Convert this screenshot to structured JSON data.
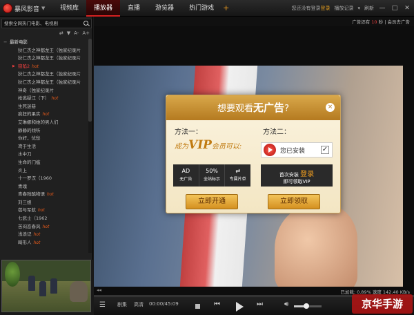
{
  "app": {
    "name": "暴风影音",
    "tabs": [
      "视频库",
      "播放器",
      "直播",
      "游览器",
      "热门游戏"
    ],
    "active_tab": 1,
    "plus": "+",
    "login_prompt": "您还没有登录",
    "login_link": "登录",
    "history": "播放记录",
    "refresh": "刷新"
  },
  "sidebar": {
    "search_placeholder": "搜索全网热门电影、电视剧",
    "tools": [
      "⇄",
      "▼",
      "A-",
      "A+"
    ],
    "folder": "最新电影",
    "items": [
      {
        "title": "狄仁杰之神都龙王（独家纪录片",
        "hot": false,
        "active": false
      },
      {
        "title": "狄仁杰之神都龙王（独家纪录片",
        "hot": false,
        "active": false
      },
      {
        "title": "窥陷2",
        "hot": true,
        "active": true
      },
      {
        "title": "狄仁杰之神都龙王（独家纪录片",
        "hot": false,
        "active": false
      },
      {
        "title": "狄仁杰之神都龙王（独家纪录片",
        "hot": false,
        "active": false
      },
      {
        "title": "神奇（独家纪录片",
        "hot": false,
        "active": false
      },
      {
        "title": "枪逃疑江（下）",
        "hot": true,
        "active": false
      },
      {
        "title": "生死迷巷",
        "hot": false,
        "active": false
      },
      {
        "title": "疯狂的果实",
        "hot": true,
        "active": false
      },
      {
        "title": "艾琳娜和她的男人们",
        "hot": false,
        "active": false
      },
      {
        "title": "静静的倾听",
        "hot": false,
        "active": false
      },
      {
        "title": "你好，忧愁",
        "hot": false,
        "active": false
      },
      {
        "title": "鸢于生活",
        "hot": false,
        "active": false
      },
      {
        "title": "水中刀",
        "hot": false,
        "active": false
      },
      {
        "title": "生命的门槛",
        "hot": false,
        "active": false
      },
      {
        "title": "炎上",
        "hot": false,
        "active": false
      },
      {
        "title": "十一罗汉（1960",
        "hot": false,
        "active": false
      },
      {
        "title": "青魂",
        "hot": false,
        "active": false
      },
      {
        "title": "青春残酷物语",
        "hot": true,
        "active": false
      },
      {
        "title": "刘三姐",
        "hot": false,
        "active": false
      },
      {
        "title": "蓓与军航",
        "hot": true,
        "active": false
      },
      {
        "title": "七武士（1962",
        "hot": false,
        "active": false
      },
      {
        "title": "苦闷恋春风",
        "hot": true,
        "active": false
      },
      {
        "title": "浅浪记",
        "hot": true,
        "active": false
      },
      {
        "title": "畸形人",
        "hot": true,
        "active": false
      }
    ],
    "hot_label": "hot",
    "collapse": "◂"
  },
  "ad": {
    "prefix": "广告还有",
    "seconds": "10",
    "suffix": "秒",
    "remove": "会员去广告",
    "close_sep": "|"
  },
  "popup": {
    "title_a": "想要观看",
    "title_b": "无广告",
    "title_c": "?",
    "method1": "方法一：",
    "method2": "方法二：",
    "vip_pre": "成为",
    "vip": "VIP",
    "vip_post": "会员可以:",
    "features": [
      {
        "icon": "AD",
        "label": "无广告"
      },
      {
        "icon": "50%",
        "label": "全站标示"
      },
      {
        "icon": "⇄",
        "label": "专属片单"
      }
    ],
    "installed": "您已安装",
    "check": "✓",
    "gift_pre": "首次安装",
    "gift_hl": "登录",
    "gift_post": "即可领取VIP",
    "btn_open": "立即开通",
    "btn_claim": "立即领取",
    "close": "×"
  },
  "player": {
    "status_left": "◂◂",
    "status_right": "已加载: 0.89% 速度 142.40 KB/s",
    "list_label": "剧集",
    "quality": "高清",
    "time": "00:00/45:09",
    "prev": "⏮",
    "next": "⏭",
    "volume_level": 0.45,
    "list_icon": "☰"
  },
  "watermark": "京华手游",
  "colors": {
    "accent": "#d52020",
    "gold": "#c07a10",
    "hot": "#e85a1a"
  }
}
